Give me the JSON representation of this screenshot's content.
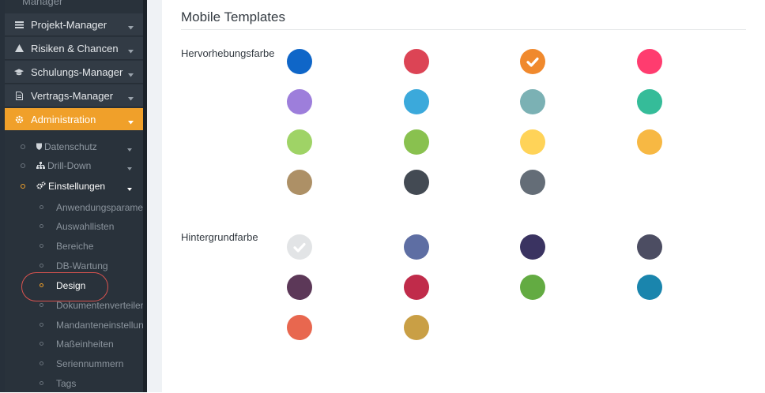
{
  "sidebar": {
    "cut_label": "Manager",
    "menu": [
      {
        "label": "Projekt-Manager",
        "icon": "list-icon"
      },
      {
        "label": "Risiken & Chancen",
        "icon": "warning-icon"
      },
      {
        "label": "Schulungs-Manager",
        "icon": "graduation-cap-icon"
      },
      {
        "label": "Vertrags-Manager",
        "icon": "document-icon"
      },
      {
        "label": "Administration",
        "icon": "gear-icon",
        "active": true
      }
    ],
    "submenu": [
      {
        "label": "Datenschutz",
        "icon": "shield-icon"
      },
      {
        "label": "Drill-Down",
        "icon": "sitemap-icon"
      },
      {
        "label": "Einstellungen",
        "icon": "gears-icon",
        "open": true
      }
    ],
    "leaves": [
      "Anwendungsparameter",
      "Auswahllisten",
      "Bereiche",
      "DB-Wartung",
      "Design",
      "Dokumentenverteiler",
      "Mandanteneinstellungen",
      "Maßeinheiten",
      "Seriennummern",
      "Tags"
    ],
    "active_leaf": "Design"
  },
  "main": {
    "title": "Mobile Templates",
    "highlight": {
      "label": "Hervorhebungsfarbe",
      "selected": "#f0892d",
      "colors": [
        "#0f66c8",
        "#dc4455",
        "#f0892d",
        "#ff3c6f",
        "#9d7edb",
        "#3ba9db",
        "#7bb1b4",
        "#35bc99",
        "#9fd366",
        "#89c14f",
        "#ffd358",
        "#f7b843",
        "#ad9066",
        "#434a53",
        "#646d77"
      ]
    },
    "background": {
      "label": "Hintergrundfarbe",
      "selected": "#e2e4e6",
      "colors": [
        "#e2e4e6",
        "#5e6ea3",
        "#3a3361",
        "#4c4d62",
        "#5c3858",
        "#c02b4a",
        "#63ab42",
        "#1a85ad",
        "#e8674f",
        "#c99f45"
      ]
    }
  }
}
